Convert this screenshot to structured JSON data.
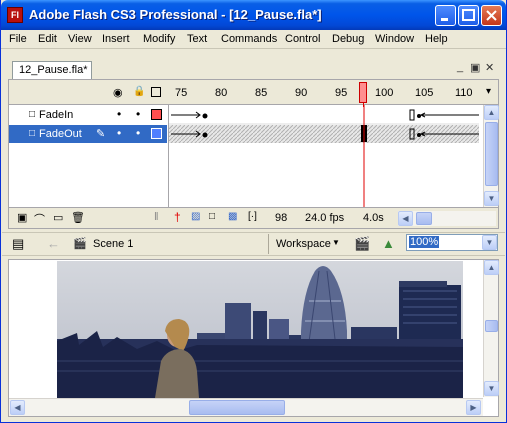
{
  "window": {
    "title": "Adobe Flash CS3 Professional - [12_Pause.fla*]",
    "app_icon_text": "Fl"
  },
  "menu": [
    "File",
    "Edit",
    "View",
    "Insert",
    "Modify",
    "Text",
    "Commands",
    "Control",
    "Debug",
    "Window",
    "Help"
  ],
  "document_tab": "12_Pause.fla*",
  "timeline": {
    "frame_numbers": [
      "75",
      "80",
      "85",
      "90",
      "95",
      "100",
      "105",
      "110"
    ],
    "layers": [
      {
        "name": "FadeIn",
        "selected": false,
        "color": "#ff4f4f"
      },
      {
        "name": "FadeOut",
        "selected": true,
        "color": "#4f7fff"
      }
    ],
    "status": {
      "current_frame": "98",
      "fps": "24.0 fps",
      "time": "4.0s"
    }
  },
  "editbar": {
    "scene": "Scene 1",
    "workspace": "Workspace",
    "zoom": "100%"
  },
  "colors": {
    "titlebar": "#0055ea",
    "selection": "#316ac5",
    "playhead": "#e00000"
  }
}
